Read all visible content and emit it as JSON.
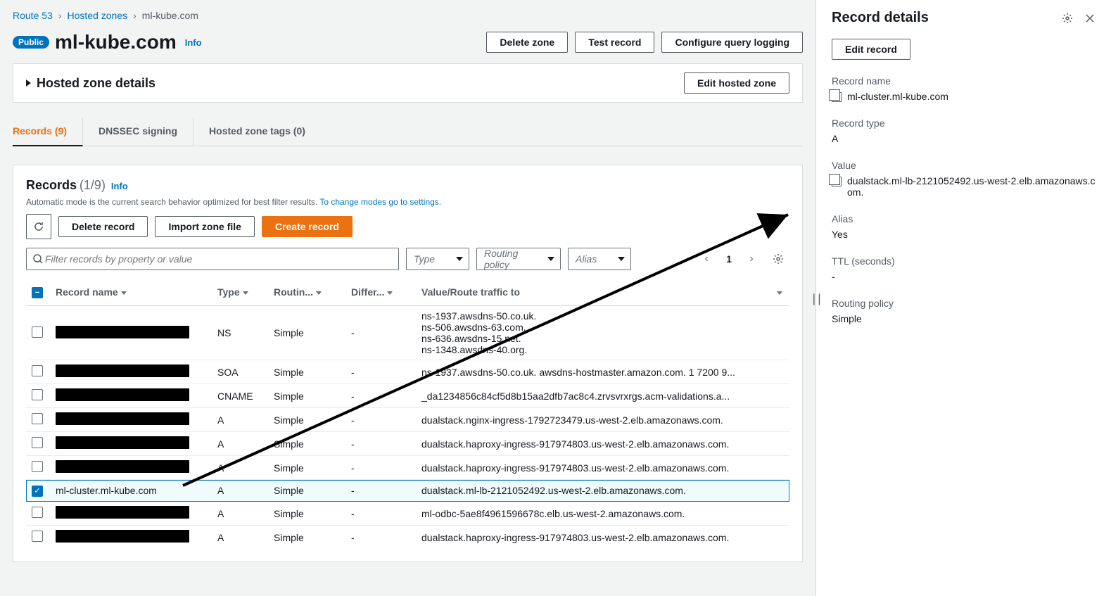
{
  "breadcrumb": {
    "root": "Route 53",
    "zones": "Hosted zones",
    "current": "ml-kube.com"
  },
  "header": {
    "badge": "Public",
    "title": "ml-kube.com",
    "info": "Info",
    "delete": "Delete zone",
    "test": "Test record",
    "logging": "Configure query logging"
  },
  "details_panel": {
    "title": "Hosted zone details",
    "edit": "Edit hosted zone"
  },
  "tabs": {
    "records": "Records (9)",
    "dnssec": "DNSSEC signing",
    "tags": "Hosted zone tags (0)"
  },
  "records_section": {
    "title": "Records",
    "count": "(1/9)",
    "info": "Info",
    "desc_a": "Automatic mode is the current search behavior optimized for best filter results. ",
    "desc_link": "To change modes go to settings.",
    "delete": "Delete record",
    "import": "Import zone file",
    "create": "Create record",
    "filter_placeholder": "Filter records by property or value",
    "type_ph": "Type",
    "routing_ph": "Routing policy",
    "alias_ph": "Alias",
    "page": "1",
    "cols": {
      "name": "Record name",
      "type": "Type",
      "routing": "Routin...",
      "diff": "Differ...",
      "value": "Value/Route traffic to"
    }
  },
  "rows": [
    {
      "selected": false,
      "redacted": true,
      "name": "",
      "type": "NS",
      "routing": "Simple",
      "diff": "-",
      "value": "ns-1937.awsdns-50.co.uk.\nns-506.awsdns-63.com.\nns-636.awsdns-15.net.\nns-1348.awsdns-40.org."
    },
    {
      "selected": false,
      "redacted": true,
      "name": "",
      "type": "SOA",
      "routing": "Simple",
      "diff": "-",
      "value": "ns-1937.awsdns-50.co.uk. awsdns-hostmaster.amazon.com. 1 7200 9..."
    },
    {
      "selected": false,
      "redacted": true,
      "name": "",
      "type": "CNAME",
      "routing": "Simple",
      "diff": "-",
      "value": "_da1234856c84cf5d8b15aa2dfb7ac8c4.zrvsvrxrgs.acm-validations.a..."
    },
    {
      "selected": false,
      "redacted": true,
      "name": "",
      "type": "A",
      "routing": "Simple",
      "diff": "-",
      "value": "dualstack.nginx-ingress-1792723479.us-west-2.elb.amazonaws.com."
    },
    {
      "selected": false,
      "redacted": true,
      "name": "",
      "type": "A",
      "routing": "Simple",
      "diff": "-",
      "value": "dualstack.haproxy-ingress-917974803.us-west-2.elb.amazonaws.com."
    },
    {
      "selected": false,
      "redacted": true,
      "name": "",
      "type": "A",
      "routing": "Simple",
      "diff": "-",
      "value": "dualstack.haproxy-ingress-917974803.us-west-2.elb.amazonaws.com."
    },
    {
      "selected": true,
      "redacted": false,
      "name": "ml-cluster.ml-kube.com",
      "type": "A",
      "routing": "Simple",
      "diff": "-",
      "value": "dualstack.ml-lb-2121052492.us-west-2.elb.amazonaws.com."
    },
    {
      "selected": false,
      "redacted": true,
      "name": "",
      "type": "A",
      "routing": "Simple",
      "diff": "-",
      "value": "ml-odbc-5ae8f4961596678c.elb.us-west-2.amazonaws.com."
    },
    {
      "selected": false,
      "redacted": true,
      "name": "",
      "type": "A",
      "routing": "Simple",
      "diff": "-",
      "value": "dualstack.haproxy-ingress-917974803.us-west-2.elb.amazonaws.com."
    }
  ],
  "detail": {
    "title": "Record details",
    "edit": "Edit record",
    "name_l": "Record name",
    "name_v": "ml-cluster.ml-kube.com",
    "type_l": "Record type",
    "type_v": "A",
    "value_l": "Value",
    "value_v": "dualstack.ml-lb-2121052492.us-west-2.elb.amazonaws.com.",
    "alias_l": "Alias",
    "alias_v": "Yes",
    "ttl_l": "TTL (seconds)",
    "ttl_v": "-",
    "rp_l": "Routing policy",
    "rp_v": "Simple"
  }
}
